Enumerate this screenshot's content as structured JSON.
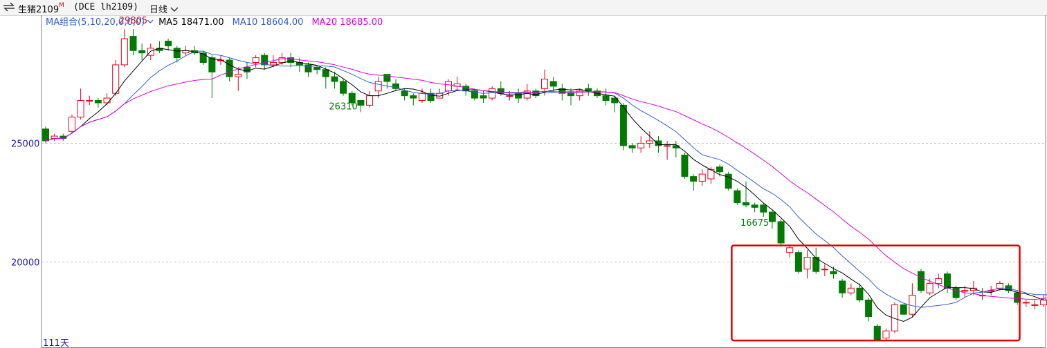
{
  "toolbar": {
    "icon": "swap-arrows-icon",
    "symbol_name": "生猪2109",
    "symbol_flag": "M",
    "contract": "(DCE lh2109)",
    "period": "日线",
    "period_dropdown_icon": "chevron-down-icon"
  },
  "ma_legend": {
    "group_label": "MA组合(5,10,20,0,0,0)",
    "items": [
      {
        "label": "MA5 18471.00",
        "color": "#000000"
      },
      {
        "label": "MA10 18604.00",
        "color": "#2f5fd0"
      },
      {
        "label": "MA20 18685.00",
        "color": "#e000e0"
      }
    ]
  },
  "footer_label": "111天",
  "colors": {
    "up": "#e8001c",
    "down": "#007a00",
    "grid": "#c0c0c0",
    "frame": "#7f7f7f",
    "highlight": "#e00000"
  },
  "chart_data": {
    "type": "candlestick",
    "y_ticks": [
      20000,
      25000
    ],
    "ylim": [
      16380,
      30390
    ],
    "highlight_region": {
      "x_from": 79,
      "x_to": 110,
      "y_from": 17800,
      "y_to": 20000
    },
    "annotations": [
      {
        "text": "29805",
        "x": 10,
        "y": 29805,
        "position": "above",
        "color": "#e8001c"
      },
      {
        "text": "26310",
        "x": 34,
        "y": 26310,
        "position": "below",
        "color": "#007a00"
      },
      {
        "text": "16675",
        "x": 81,
        "y": 16675,
        "position": "below",
        "color": "#007a00"
      }
    ],
    "candles": [
      [
        25600,
        25100,
        25700,
        25000
      ],
      [
        25200,
        25300,
        25400,
        25100
      ],
      [
        25300,
        25200,
        25400,
        25100
      ],
      [
        25500,
        26100,
        26200,
        25400
      ],
      [
        26100,
        26800,
        27300,
        26000
      ],
      [
        26800,
        26800,
        27000,
        26600
      ],
      [
        26800,
        26700,
        26900,
        26500
      ],
      [
        26700,
        26900,
        27100,
        26600
      ],
      [
        27100,
        28300,
        28500,
        27000
      ],
      [
        28300,
        29400,
        29800,
        28200
      ],
      [
        29500,
        28900,
        29805,
        28700
      ],
      [
        28900,
        28800,
        29200,
        28500
      ],
      [
        28700,
        29000,
        29200,
        28500
      ],
      [
        29000,
        28900,
        29300,
        28800
      ],
      [
        29300,
        29100,
        29400,
        28900
      ],
      [
        29000,
        28600,
        29100,
        28400
      ],
      [
        28800,
        28900,
        29100,
        28700
      ],
      [
        28900,
        28800,
        29100,
        28700
      ],
      [
        28800,
        28400,
        28900,
        28300
      ],
      [
        28600,
        28000,
        28700,
        26900
      ],
      [
        28500,
        28500,
        28700,
        28300
      ],
      [
        28500,
        27800,
        28600,
        27600
      ],
      [
        27800,
        27900,
        28200,
        27200
      ],
      [
        28200,
        28000,
        28400,
        27700
      ],
      [
        28400,
        28600,
        28700,
        28200
      ],
      [
        28700,
        28300,
        28800,
        28100
      ],
      [
        28300,
        28400,
        28700,
        28200
      ],
      [
        28400,
        28600,
        28800,
        28300
      ],
      [
        28600,
        28400,
        28800,
        28200
      ],
      [
        28400,
        28300,
        28600,
        28000
      ],
      [
        28300,
        28000,
        28400,
        27800
      ],
      [
        28200,
        28100,
        28300,
        27900
      ],
      [
        28100,
        27800,
        28200,
        27300
      ],
      [
        27800,
        27600,
        28000,
        27300
      ],
      [
        27600,
        27100,
        27700,
        27000
      ],
      [
        27100,
        26700,
        27200,
        26600
      ],
      [
        26800,
        26600,
        26700,
        26310
      ],
      [
        26600,
        27000,
        27200,
        26500
      ],
      [
        27200,
        27600,
        27800,
        26900
      ],
      [
        27900,
        27600,
        27900,
        27300
      ],
      [
        27500,
        27300,
        27700,
        27200
      ],
      [
        27200,
        27000,
        27300,
        26800
      ],
      [
        27000,
        26900,
        27100,
        26600
      ],
      [
        26800,
        27100,
        27300,
        26700
      ],
      [
        27100,
        26800,
        27300,
        26700
      ],
      [
        26900,
        27100,
        27300,
        26900
      ],
      [
        27200,
        27600,
        27700,
        27000
      ],
      [
        27400,
        27500,
        27800,
        27200
      ],
      [
        27400,
        27200,
        27500,
        27000
      ],
      [
        27200,
        26900,
        27300,
        26800
      ],
      [
        27000,
        26900,
        27200,
        26700
      ],
      [
        26900,
        27300,
        27400,
        26800
      ],
      [
        27300,
        27100,
        27600,
        27000
      ],
      [
        27000,
        27000,
        27200,
        26800
      ],
      [
        27100,
        26900,
        27300,
        26700
      ],
      [
        26900,
        27200,
        27500,
        26800
      ],
      [
        27200,
        27000,
        27300,
        26900
      ],
      [
        27300,
        27700,
        28100,
        27000
      ],
      [
        27600,
        27400,
        27800,
        27200
      ],
      [
        27300,
        27100,
        27500,
        26800
      ],
      [
        27100,
        27000,
        27300,
        26600
      ],
      [
        27000,
        27200,
        27300,
        26800
      ],
      [
        27300,
        27200,
        27500,
        27000
      ],
      [
        27200,
        27000,
        27300,
        26900
      ],
      [
        27000,
        26800,
        27300,
        26600
      ],
      [
        26900,
        26700,
        27000,
        26300
      ],
      [
        26600,
        24900,
        26700,
        24700
      ],
      [
        24900,
        24800,
        25000,
        24600
      ],
      [
        24800,
        25000,
        25300,
        24600
      ],
      [
        25000,
        25100,
        25500,
        24800
      ],
      [
        25100,
        24900,
        25300,
        24600
      ],
      [
        24900,
        24900,
        25100,
        24300
      ],
      [
        24900,
        24800,
        25100,
        24400
      ],
      [
        24500,
        23600,
        24600,
        23500
      ],
      [
        23600,
        23400,
        23700,
        23000
      ],
      [
        23400,
        23700,
        23900,
        23200
      ],
      [
        23500,
        23900,
        24000,
        23300
      ],
      [
        24000,
        23800,
        24100,
        23600
      ],
      [
        23700,
        23100,
        23800,
        23000
      ],
      [
        23000,
        22500,
        23100,
        22400
      ],
      [
        22500,
        22400,
        23400,
        22300
      ],
      [
        22400,
        22300,
        22500,
        22100
      ],
      [
        22400,
        22100,
        22500,
        21900
      ],
      [
        22100,
        21700,
        22200,
        21400
      ],
      [
        21700,
        20800,
        21800,
        20700
      ],
      [
        20400,
        20600,
        20700,
        20200
      ],
      [
        20400,
        19600,
        20500,
        19500
      ],
      [
        19700,
        20200,
        20500,
        19300
      ],
      [
        20200,
        19600,
        20600,
        19500
      ],
      [
        19700,
        19700,
        19900,
        19400
      ],
      [
        19600,
        19500,
        19800,
        19300
      ],
      [
        19200,
        18700,
        19300,
        18500
      ],
      [
        18700,
        18900,
        19100,
        18600
      ],
      [
        18900,
        18400,
        19100,
        18300
      ],
      [
        18400,
        17700,
        18500,
        17500
      ],
      [
        17300,
        16700,
        17400,
        16675
      ],
      [
        16800,
        17100,
        17200,
        16675
      ],
      [
        17100,
        18200,
        18300,
        17000
      ],
      [
        18200,
        17800,
        18200,
        17800
      ],
      [
        17800,
        18600,
        19100,
        17700
      ],
      [
        19600,
        18800,
        19700,
        18700
      ],
      [
        18700,
        19100,
        19300,
        18600
      ],
      [
        19100,
        19300,
        19500,
        18900
      ],
      [
        19500,
        18900,
        19600,
        18700
      ],
      [
        18900,
        18500,
        19000,
        18400
      ],
      [
        18800,
        18800,
        19000,
        18500
      ],
      [
        18800,
        18900,
        19200,
        18600
      ],
      [
        18600,
        18600,
        18900,
        18400
      ],
      [
        18800,
        18800,
        19000,
        18600
      ],
      [
        18900,
        19100,
        19200,
        18800
      ],
      [
        19000,
        18800,
        19100,
        18700
      ],
      [
        18700,
        18300,
        18800,
        18200
      ],
      [
        18300,
        18300,
        18400,
        18100
      ],
      [
        18200,
        18200,
        18400,
        18000
      ],
      [
        18200,
        18400,
        18600,
        18100
      ],
      [
        18400,
        18700,
        18900,
        18300
      ],
      [
        18700,
        18800,
        19000,
        18600
      ]
    ]
  }
}
